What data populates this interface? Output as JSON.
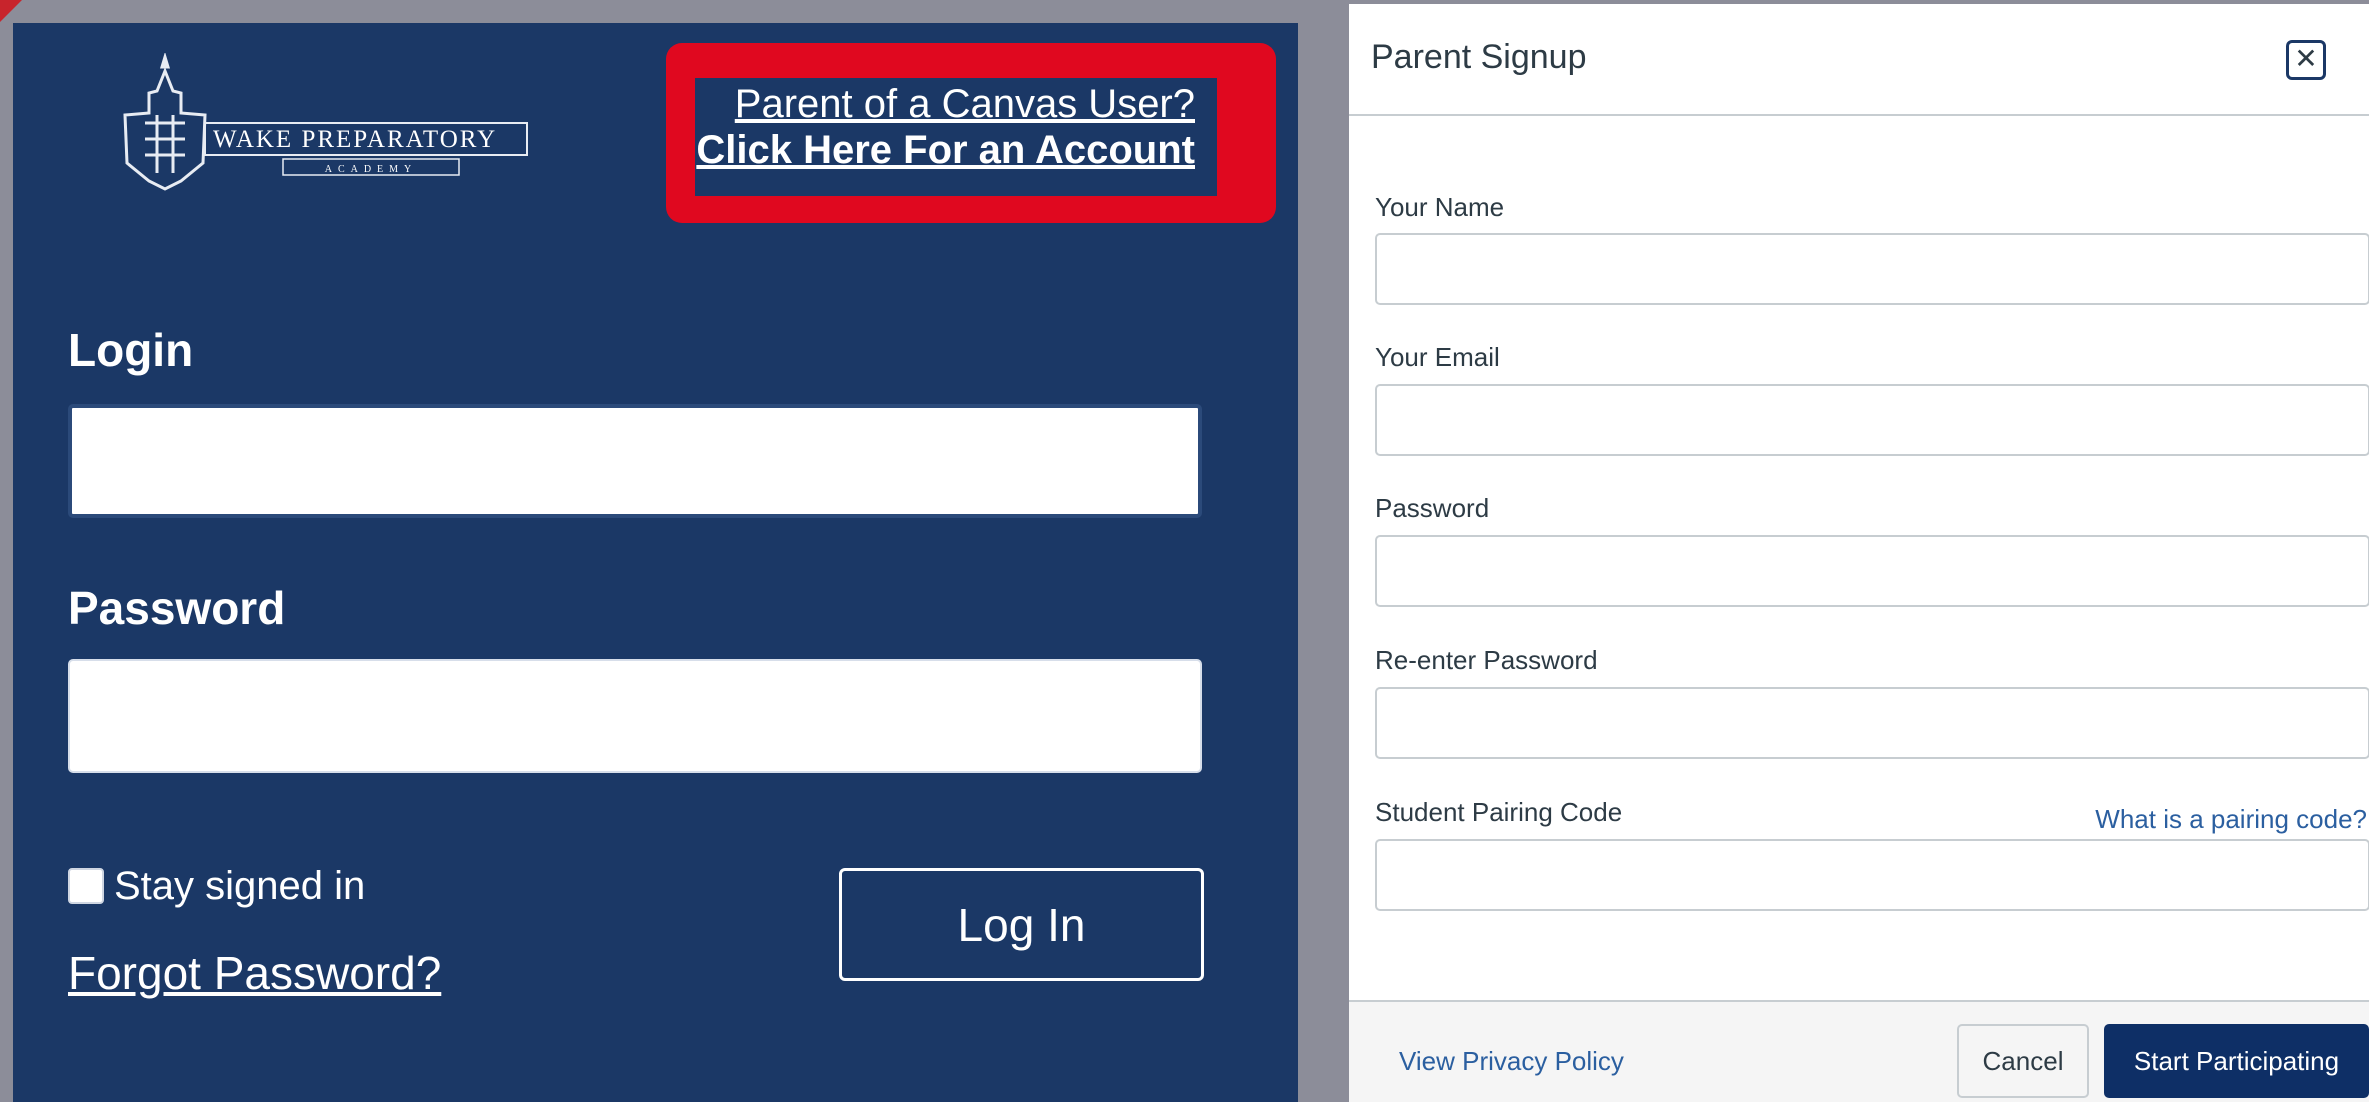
{
  "login_panel": {
    "logo_text": "WAKE PREPARATORY",
    "logo_subtext": "ACADEMY",
    "parent_link_line1": "Parent of a Canvas User?",
    "parent_link_line2": "Click Here For an Account",
    "login_label": "Login",
    "password_label": "Password",
    "stay_signed_in": "Stay signed in",
    "forgot_password": "Forgot Password?",
    "login_button": "Log In"
  },
  "signup_dialog": {
    "title": "Parent Signup",
    "close_glyph": "✕",
    "fields": {
      "name_label": "Your Name",
      "email_label": "Your Email",
      "password_label": "Password",
      "reenter_label": "Re-enter Password",
      "pairing_label": "Student Pairing Code",
      "pairing_help": "What is a pairing code?"
    },
    "footer": {
      "privacy": "View Privacy Policy",
      "cancel": "Cancel",
      "start": "Start Participating"
    }
  },
  "colors": {
    "panel_bg": "#1b3866",
    "highlight_red": "#e0081f",
    "backdrop": "#8c8d99",
    "primary_button": "#0e2f66",
    "link_blue": "#2b5fa0"
  }
}
